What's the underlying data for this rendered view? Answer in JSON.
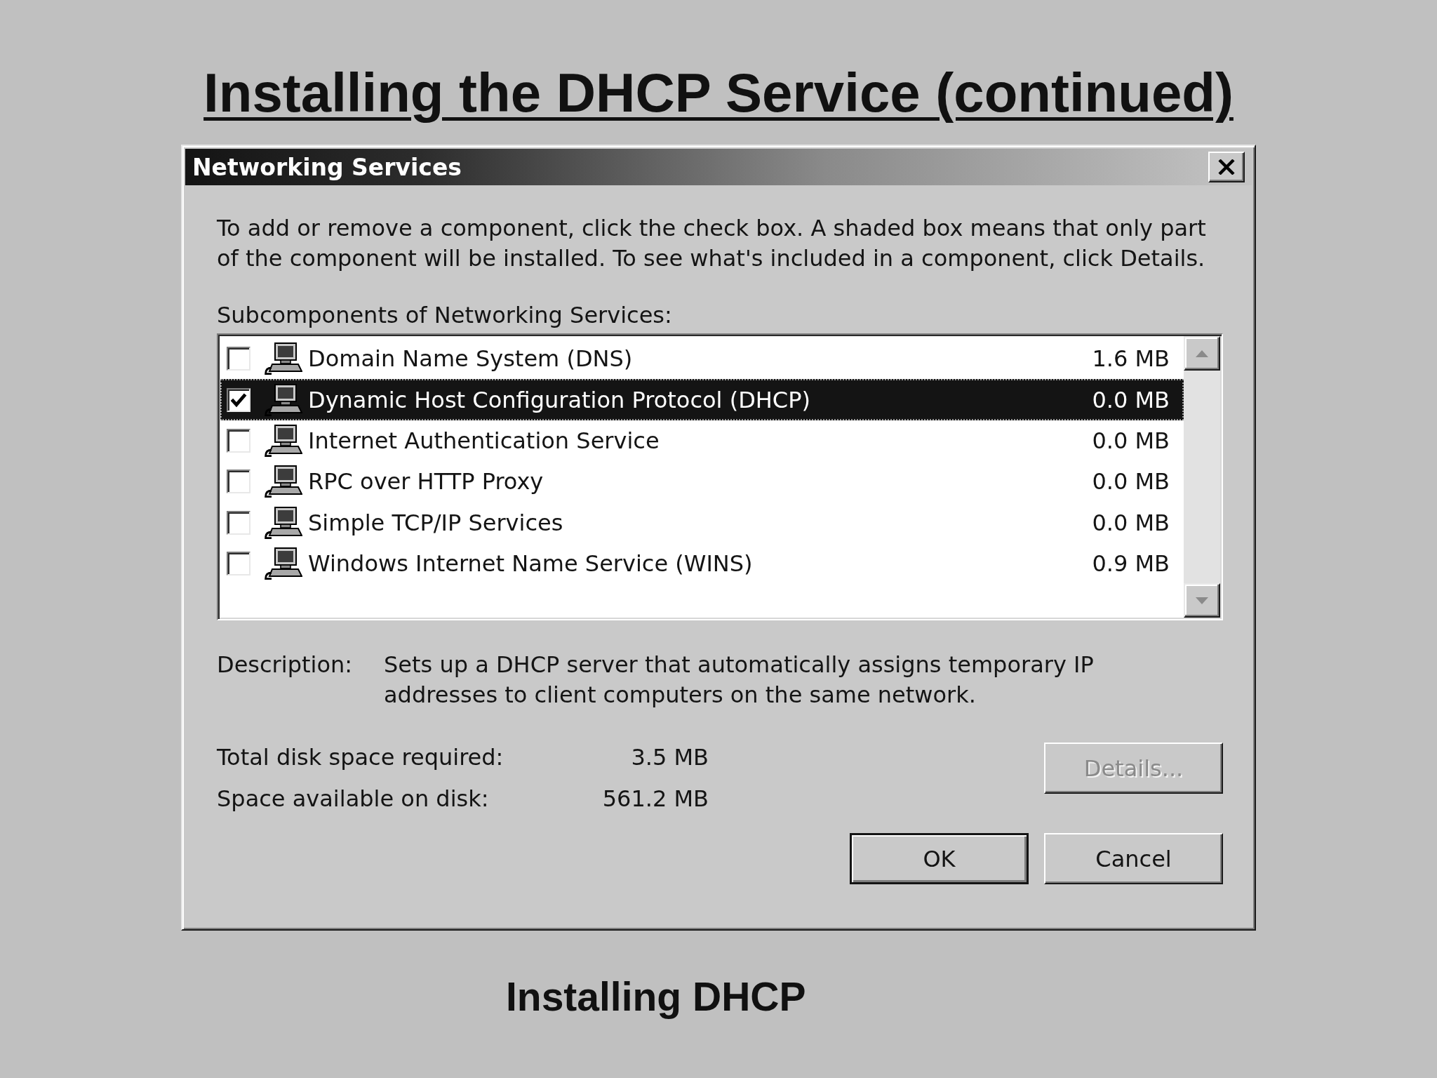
{
  "slide": {
    "title": "Installing the DHCP Service (continued)",
    "caption": "Installing DHCP"
  },
  "window": {
    "title": "Networking Services"
  },
  "instructions": "To add or remove a component, click the check box. A shaded box means that only part of the component will be installed. To see what's included in a component, click Details.",
  "list_label": "Subcomponents of Networking Services:",
  "components": [
    {
      "name": "Domain Name System (DNS)",
      "size": "1.6 MB",
      "checked": false,
      "selected": false
    },
    {
      "name": "Dynamic Host Configuration Protocol (DHCP)",
      "size": "0.0 MB",
      "checked": true,
      "selected": true
    },
    {
      "name": "Internet Authentication Service",
      "size": "0.0 MB",
      "checked": false,
      "selected": false
    },
    {
      "name": "RPC over HTTP Proxy",
      "size": "0.0 MB",
      "checked": false,
      "selected": false
    },
    {
      "name": "Simple TCP/IP Services",
      "size": "0.0 MB",
      "checked": false,
      "selected": false
    },
    {
      "name": "Windows Internet Name Service (WINS)",
      "size": "0.9 MB",
      "checked": false,
      "selected": false
    }
  ],
  "description": {
    "label": "Description:",
    "text": "Sets up a DHCP server that automatically assigns temporary IP addresses to client computers on the same network."
  },
  "disk_space": [
    {
      "label": "Total disk space required:",
      "value": "3.5 MB"
    },
    {
      "label": "Space available on disk:",
      "value": "561.2 MB"
    }
  ],
  "buttons": [
    {
      "label": "Details...",
      "disabled": true,
      "default": false
    },
    {
      "label": "OK",
      "disabled": false,
      "default": true
    },
    {
      "label": "Cancel",
      "disabled": false,
      "default": false
    }
  ]
}
